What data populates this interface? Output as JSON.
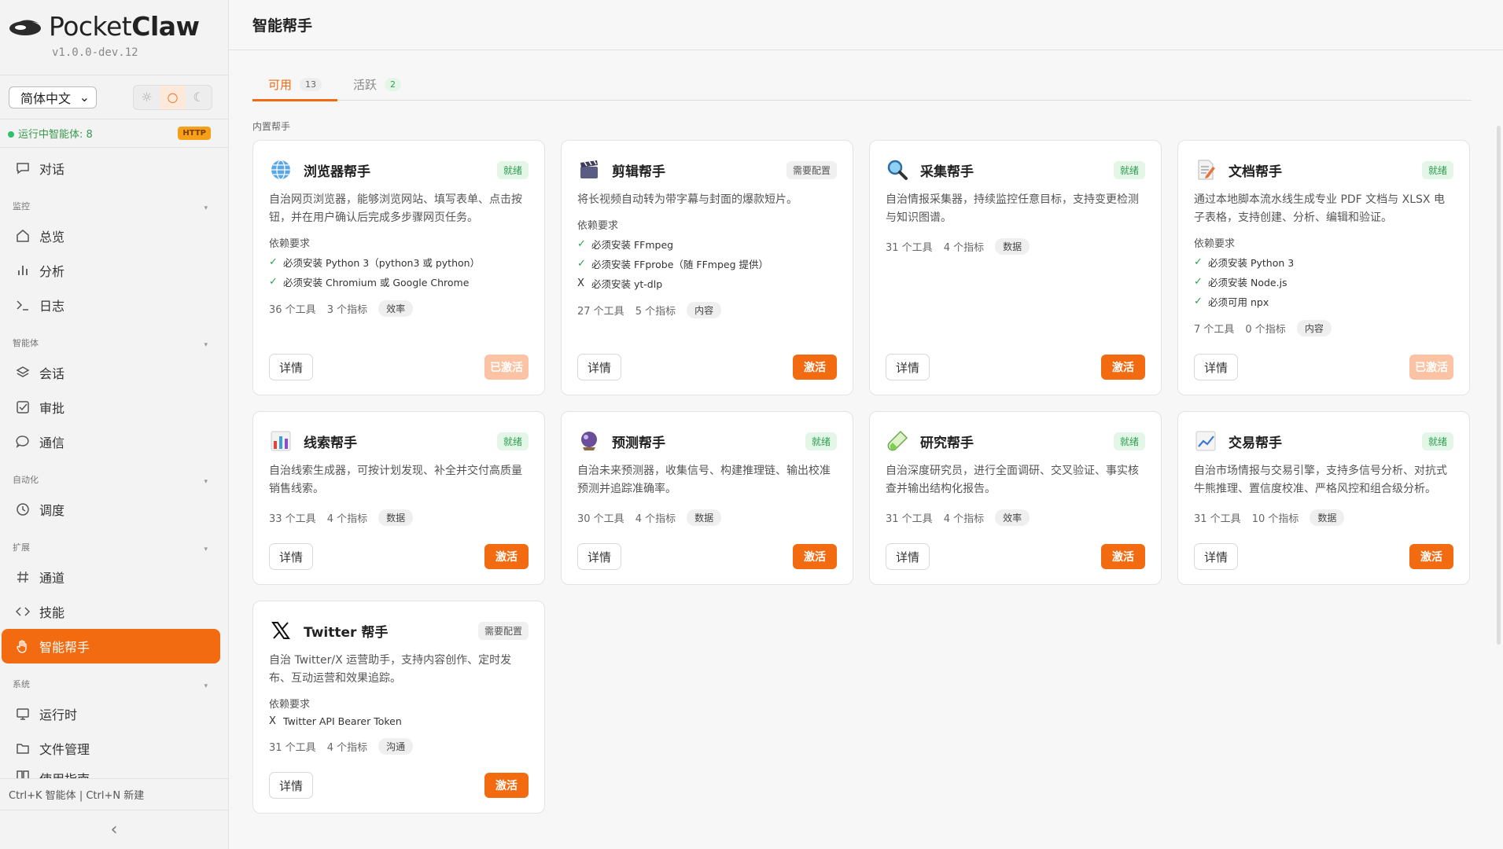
{
  "app": {
    "name_plain": "Pocket",
    "name_bold": "Claw",
    "version": "v1.0.0-dev.12"
  },
  "language": {
    "selected": "简体中文",
    "chevron": "⌄"
  },
  "theme": {
    "light": "☼",
    "system": "○",
    "dark": "☾"
  },
  "status": {
    "text": "运行中智能体: 8",
    "badge": "HTTP"
  },
  "nav": {
    "chat": {
      "label": "对话",
      "icon": "chat-icon"
    },
    "sections": {
      "monitor": "监控",
      "agents": "智能体",
      "automation": "自动化",
      "extensions": "扩展",
      "system": "系统"
    },
    "overview": "总览",
    "analytics": "分析",
    "logs": "日志",
    "sessions": "会话",
    "approvals": "审批",
    "comms": "通信",
    "scheduling": "调度",
    "channels": "通道",
    "skills": "技能",
    "hands": "智能帮手",
    "runtime": "运行时",
    "files": "文件管理",
    "partial": "使用指南"
  },
  "shortcut": "Ctrl+K 智能体 | Ctrl+N 新建",
  "collapse_icon": "‹",
  "page": {
    "title": "智能帮手"
  },
  "tabs": [
    {
      "label": "可用",
      "count": "13"
    },
    {
      "label": "活跃",
      "count": "2"
    }
  ],
  "section_label": "内置帮手",
  "colors": {
    "accent": "#f26b11",
    "ready": "#2f9e4f"
  },
  "cards": [
    {
      "title": "浏览器帮手",
      "icon": "globe-icon",
      "badge": "就绪",
      "desc": "自治网页浏览器，能够浏览网站、填写表单、点击按钮，并在用户确认后完成多步骤网页任务。",
      "req_label": "依赖要求",
      "reqs": [
        {
          "mark": "✓",
          "text": "必须安装 Python 3（python3 或 python）"
        },
        {
          "mark": "✓",
          "text": "必须安装 Chromium 或 Google Chrome"
        }
      ],
      "tools": "36 个工具",
      "metrics": "3 个指标",
      "tag": "效率",
      "detail": "详情",
      "action": "已激活"
    },
    {
      "title": "剪辑帮手",
      "icon": "clapper-icon",
      "badge": "需要配置",
      "desc": "将长视频自动转为带字幕与封面的爆款短片。",
      "req_label": "依赖要求",
      "reqs": [
        {
          "mark": "✓",
          "text": "必须安装 FFmpeg"
        },
        {
          "mark": "✓",
          "text": "必须安装 FFprobe（随 FFmpeg 提供）"
        },
        {
          "mark": "X",
          "text": "必须安装 yt-dlp"
        }
      ],
      "tools": "27 个工具",
      "metrics": "5 个指标",
      "tag": "内容",
      "detail": "详情",
      "action": "激活"
    },
    {
      "title": "采集帮手",
      "icon": "magnifier-icon",
      "badge": "就绪",
      "desc": "自治情报采集器，持续监控任意目标，支持变更检测与知识图谱。",
      "tools": "31 个工具",
      "metrics": "4 个指标",
      "tag": "数据",
      "detail": "详情",
      "action": "激活"
    },
    {
      "title": "文档帮手",
      "icon": "document-icon",
      "badge": "就绪",
      "desc": "通过本地脚本流水线生成专业 PDF 文档与 XLSX 电子表格，支持创建、分析、编辑和验证。",
      "req_label": "依赖要求",
      "reqs": [
        {
          "mark": "✓",
          "text": "必须安装 Python 3"
        },
        {
          "mark": "✓",
          "text": "必须安装 Node.js"
        },
        {
          "mark": "✓",
          "text": "必须可用 npx"
        }
      ],
      "tools": "7 个工具",
      "metrics": "0 个指标",
      "tag": "内容",
      "detail": "详情",
      "action": "已激活"
    },
    {
      "title": "线索帮手",
      "icon": "bar-chart-icon",
      "badge": "就绪",
      "desc": "自治线索生成器，可按计划发现、补全并交付高质量销售线索。",
      "tools": "33 个工具",
      "metrics": "4 个指标",
      "tag": "数据",
      "detail": "详情",
      "action": "激活"
    },
    {
      "title": "预测帮手",
      "icon": "crystal-ball-icon",
      "badge": "就绪",
      "desc": "自治未来预测器，收集信号、构建推理链、输出校准预测并追踪准确率。",
      "tools": "30 个工具",
      "metrics": "4 个指标",
      "tag": "数据",
      "detail": "详情",
      "action": "激活"
    },
    {
      "title": "研究帮手",
      "icon": "test-tube-icon",
      "badge": "就绪",
      "desc": "自治深度研究员，进行全面调研、交叉验证、事实核查并输出结构化报告。",
      "tools": "31 个工具",
      "metrics": "4 个指标",
      "tag": "效率",
      "detail": "详情",
      "action": "激活"
    },
    {
      "title": "交易帮手",
      "icon": "trend-chart-icon",
      "badge": "就绪",
      "desc": "自治市场情报与交易引擎，支持多信号分析、对抗式牛熊推理、置信度校准、严格风控和组合级分析。",
      "tools": "31 个工具",
      "metrics": "10 个指标",
      "tag": "数据",
      "detail": "详情",
      "action": "激活"
    },
    {
      "title": "Twitter 帮手",
      "icon": "x-logo-icon",
      "badge": "需要配置",
      "desc": "自治 Twitter/X 运营助手，支持内容创作、定时发布、互动运营和效果追踪。",
      "req_label": "依赖要求",
      "reqs": [
        {
          "mark": "X",
          "text": "Twitter API Bearer Token"
        }
      ],
      "tools": "31 个工具",
      "metrics": "4 个指标",
      "tag": "沟通",
      "detail": "详情",
      "action": "激活"
    }
  ]
}
